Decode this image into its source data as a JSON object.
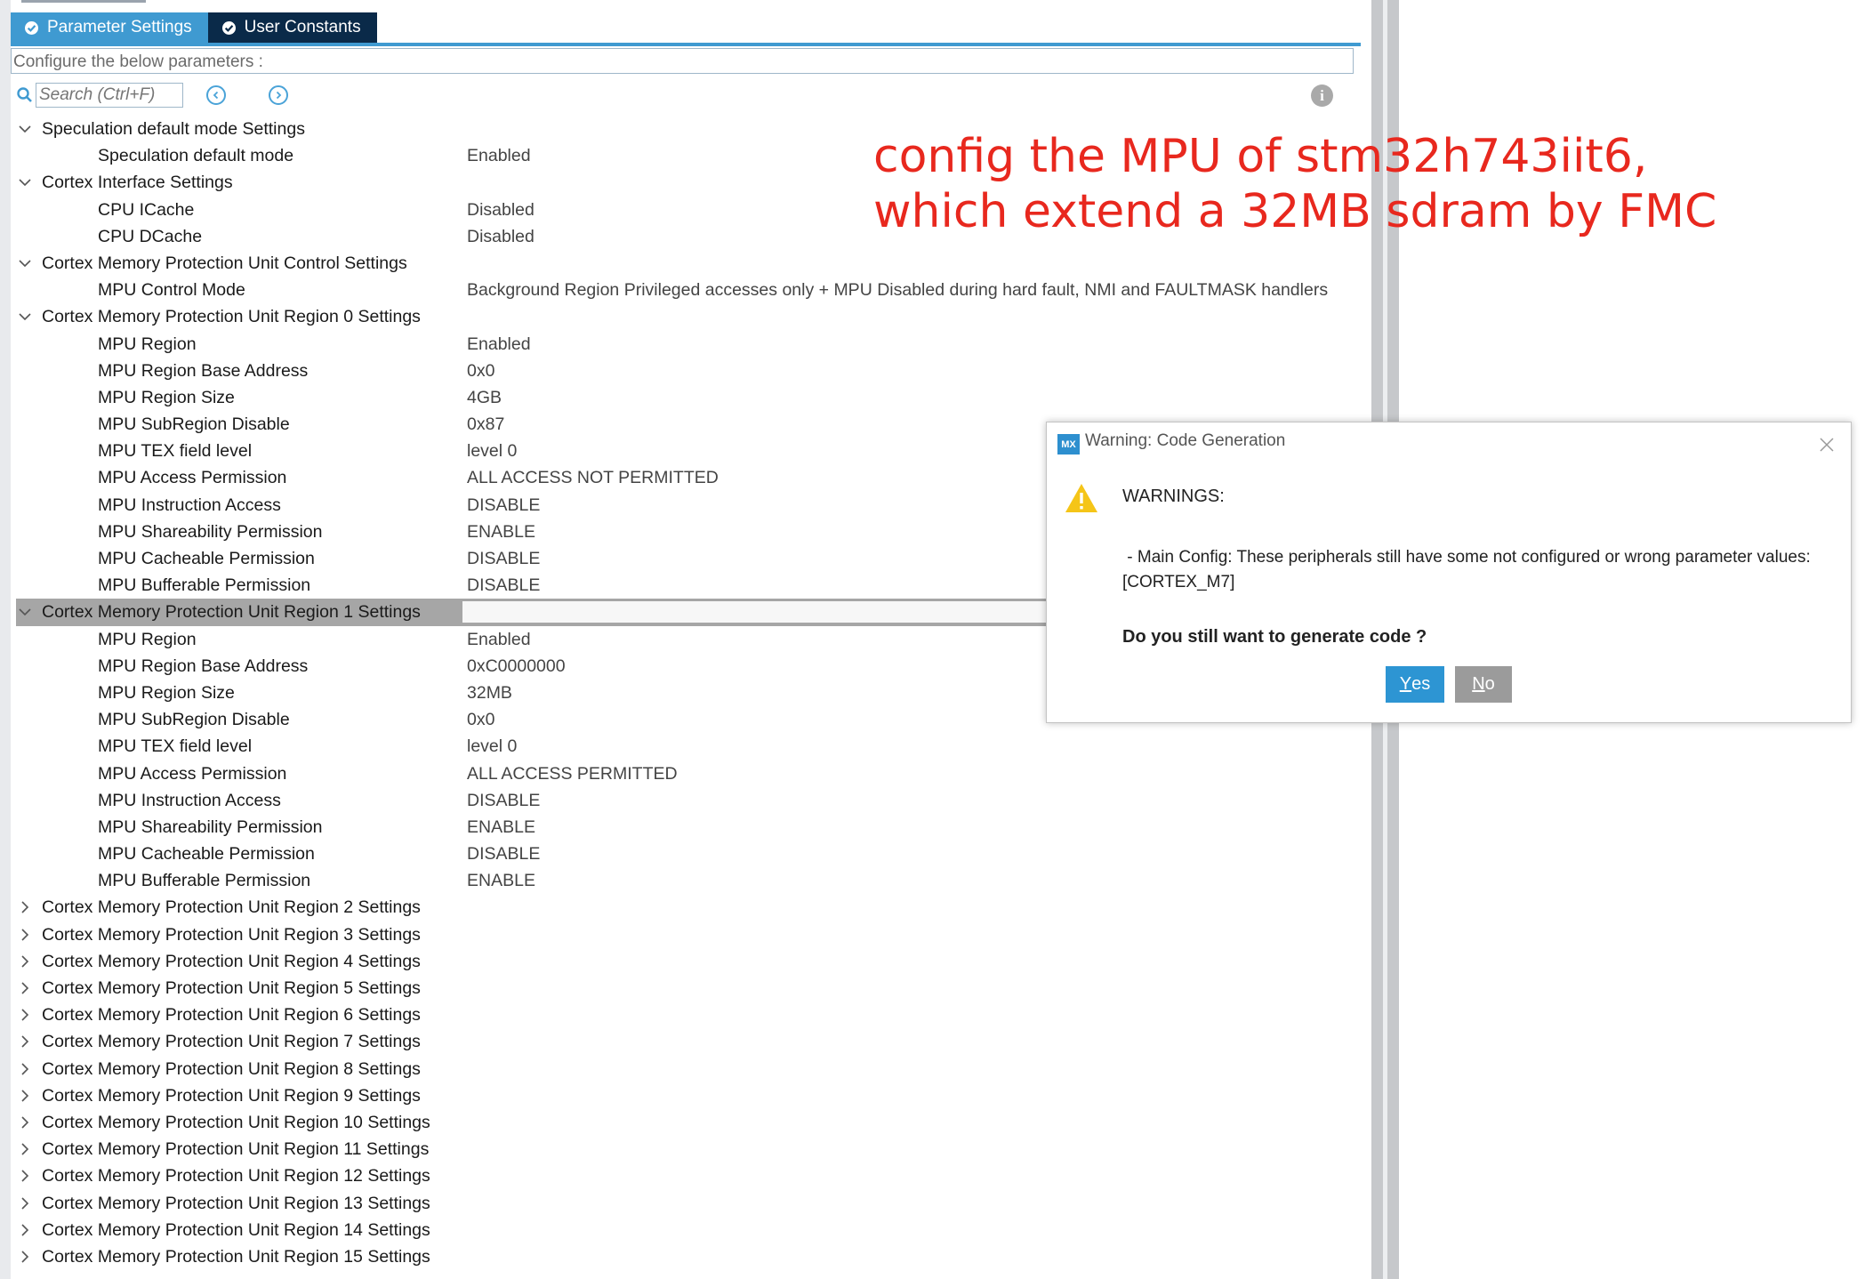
{
  "tabs": [
    {
      "label": "Parameter Settings",
      "active": true
    },
    {
      "label": "User Constants",
      "active": false
    }
  ],
  "config_hint": "Configure the below parameters :",
  "search": {
    "placeholder": "Search (Ctrl+F)"
  },
  "annotation": {
    "line1": "config the MPU of stm32h743iit6,",
    "line2": "which extend a 32MB sdram by FMC"
  },
  "tree": {
    "speculation_group": "Speculation default mode Settings",
    "speculation_mode": {
      "label": "Speculation default mode",
      "value": "Enabled"
    },
    "cortex_interface_group": "Cortex Interface Settings",
    "icache": {
      "label": "CPU ICache",
      "value": "Disabled"
    },
    "dcache": {
      "label": "CPU DCache",
      "value": "Disabled"
    },
    "mpu_control_group": "Cortex Memory Protection Unit Control Settings",
    "mpu_control_mode": {
      "label": "MPU Control Mode",
      "value": "Background Region Privileged accesses only + MPU Disabled during hard fault, NMI and FAULTMASK handlers"
    },
    "region0": {
      "group": "Cortex Memory Protection Unit Region 0 Settings",
      "params": [
        {
          "label": "MPU Region",
          "value": "Enabled"
        },
        {
          "label": "MPU Region Base Address",
          "value": "0x0"
        },
        {
          "label": "MPU Region Size",
          "value": "4GB"
        },
        {
          "label": "MPU SubRegion Disable",
          "value": "0x87"
        },
        {
          "label": "MPU TEX field level",
          "value": "level 0"
        },
        {
          "label": "MPU Access Permission",
          "value": "ALL ACCESS NOT PERMITTED"
        },
        {
          "label": "MPU Instruction Access",
          "value": "DISABLE"
        },
        {
          "label": "MPU Shareability Permission",
          "value": "ENABLE"
        },
        {
          "label": "MPU Cacheable Permission",
          "value": "DISABLE"
        },
        {
          "label": "MPU Bufferable  Permission",
          "value": "DISABLE"
        }
      ]
    },
    "region1": {
      "group": "Cortex Memory Protection Unit Region 1 Settings",
      "params": [
        {
          "label": "MPU Region",
          "value": "Enabled"
        },
        {
          "label": "MPU Region Base Address",
          "value": "0xC0000000"
        },
        {
          "label": "MPU Region Size",
          "value": "32MB"
        },
        {
          "label": "MPU SubRegion Disable",
          "value": "0x0"
        },
        {
          "label": "MPU TEX field level",
          "value": "level 0"
        },
        {
          "label": "MPU Access Permission",
          "value": "ALL ACCESS PERMITTED"
        },
        {
          "label": "MPU Instruction Access",
          "value": "DISABLE"
        },
        {
          "label": "MPU Shareability Permission",
          "value": "ENABLE"
        },
        {
          "label": "MPU Cacheable Permission",
          "value": "DISABLE"
        },
        {
          "label": "MPU Bufferable  Permission",
          "value": "ENABLE"
        }
      ]
    },
    "collapsed_groups": [
      "Cortex Memory Protection Unit Region 2 Settings",
      "Cortex Memory Protection Unit Region 3 Settings",
      "Cortex Memory Protection Unit Region 4 Settings",
      "Cortex Memory Protection Unit Region 5 Settings",
      "Cortex Memory Protection Unit Region 6 Settings",
      "Cortex Memory Protection Unit Region 7 Settings",
      "Cortex Memory Protection Unit Region 8 Settings",
      "Cortex Memory Protection Unit Region 9 Settings",
      "Cortex Memory Protection Unit Region 10 Settings",
      "Cortex Memory Protection Unit Region 11 Settings",
      "Cortex Memory Protection Unit Region 12 Settings",
      "Cortex Memory Protection Unit Region 13 Settings",
      "Cortex Memory Protection Unit Region 14 Settings",
      "Cortex Memory Protection Unit Region 15 Settings"
    ]
  },
  "dialog": {
    "logo": "MX",
    "title": "Warning: Code Generation",
    "heading": "WARNINGS:",
    "message_line1": " - Main Config: These peripherals still have some not configured or wrong parameter values:",
    "message_line2": "[CORTEX_M7]",
    "question": "Do you still want to generate code ?",
    "yes_first": "Y",
    "yes_rest": "es",
    "no_first": "N",
    "no_rest": "o"
  },
  "colors": {
    "accent": "#3f9ad1",
    "tab_inactive": "#0a2a49",
    "annotation": "#e8281e",
    "warning": "#f5c518",
    "selected_row": "#a6a6a6"
  }
}
